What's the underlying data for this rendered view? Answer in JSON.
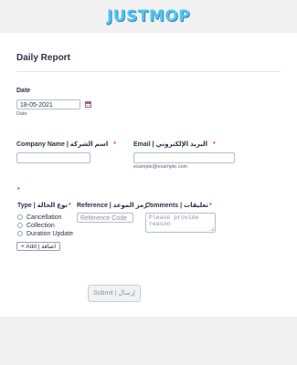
{
  "brand": {
    "logo_text": "JUSTMOP",
    "logo_color": "#55c4ee"
  },
  "form": {
    "title": "Daily Report",
    "date": {
      "label": "Date",
      "value": "18-05-2021",
      "sublabel": "Date",
      "icon": "calendar-icon"
    },
    "company": {
      "label": "Company Name | اسم الشركة",
      "required_mark": "*",
      "value": ""
    },
    "email": {
      "label": "Email | البريد الإلكتروني",
      "required_mark": "*",
      "value": "",
      "sublabel": "example@example.com"
    },
    "table": {
      "required_mark": "*",
      "type_header": "Type | نوع الحالة",
      "type_required": "*",
      "reference_header": "Reference | رمز الموعد",
      "reference_required": "*",
      "comments_header": "Comments | تعليقات",
      "comments_required": "*",
      "type_options": [
        "Cancellation",
        "Collection",
        "Duration Update"
      ],
      "reference_placeholder": "Reference Code",
      "comments_placeholder": "Please provide reason",
      "add_button": "+ Add | اضافة"
    },
    "submit_label": "Submit | إرسال"
  }
}
